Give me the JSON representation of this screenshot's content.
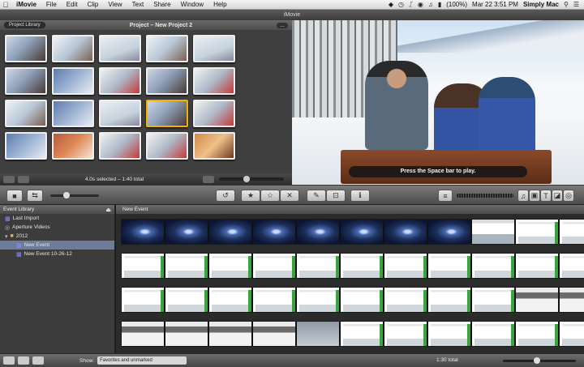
{
  "menubar": {
    "items": [
      "iMovie",
      "File",
      "Edit",
      "Clip",
      "View",
      "Text",
      "Share",
      "Window",
      "Help"
    ],
    "datetime": "Mar 22  3:51 PM",
    "user": "Simply Mac",
    "battery": "(100%)"
  },
  "window": {
    "title": "iMovie"
  },
  "project": {
    "library_button": "Project Library",
    "title": "Project – New Project 2",
    "more_button": "...",
    "selection_info": "4.0s selected – 1:40 total"
  },
  "viewer": {
    "hint": "Press the Space bar to play."
  },
  "event_library": {
    "header": "Event Library",
    "items": [
      {
        "label": "Last Import"
      },
      {
        "label": "Aperture Videos"
      },
      {
        "label": "2012"
      },
      {
        "label": "New Event"
      },
      {
        "label": "New Event 10-26-12"
      }
    ]
  },
  "event_main": {
    "title": "New Event"
  },
  "statusbar": {
    "show_label": "Show:",
    "show_value": "Favorites and unmarked",
    "total": "1:30 total"
  },
  "icons": {
    "apple": "apple-icon",
    "folder": "folder-icon",
    "film": "film-icon"
  },
  "colors": {
    "selection_highlight": "#f0b400",
    "event_selected_row": "#6d7c98"
  }
}
